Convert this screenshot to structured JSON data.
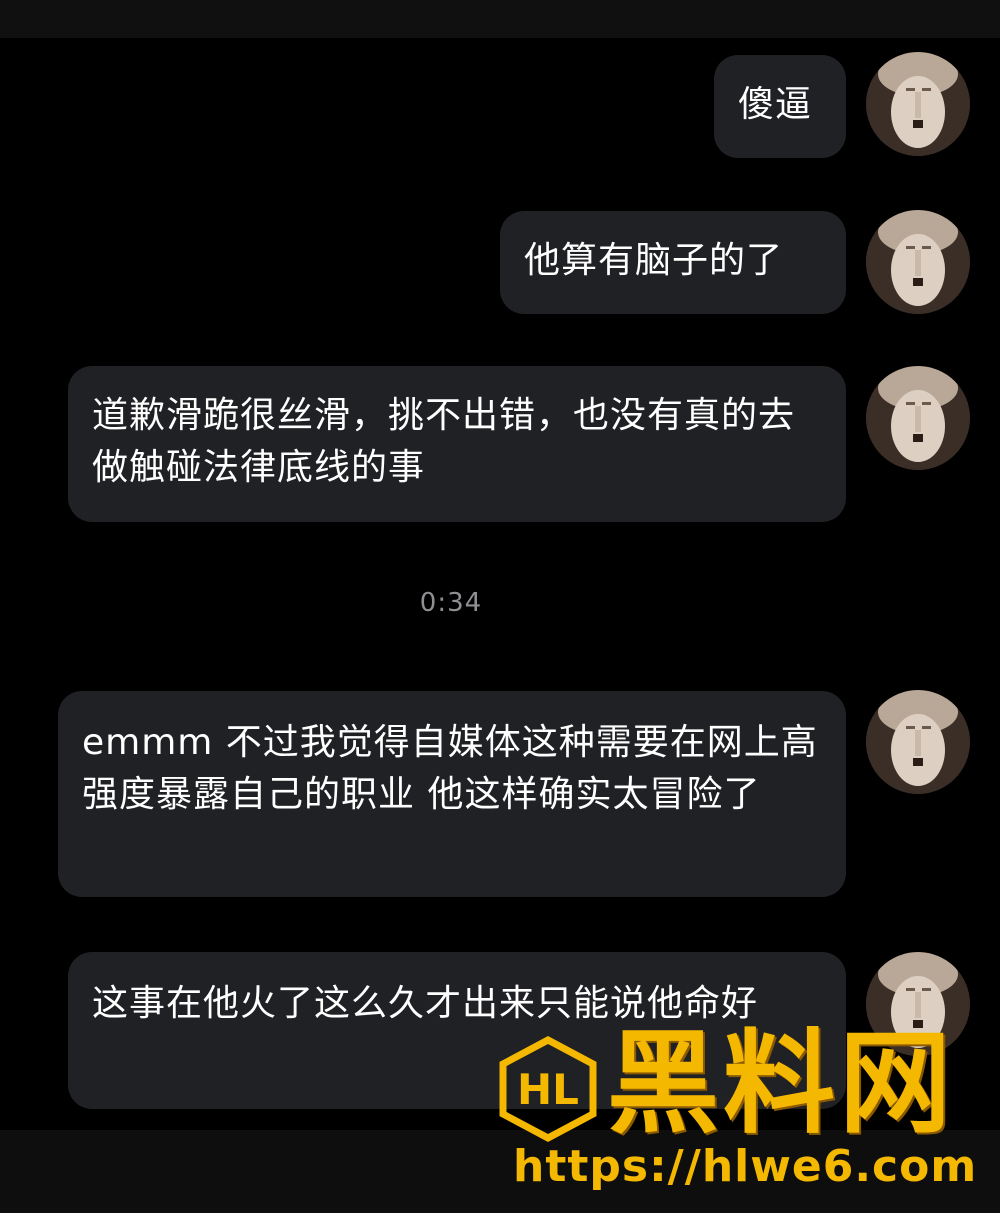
{
  "chat": {
    "timestamp": "0:34",
    "messages": [
      {
        "text": "傻逼"
      },
      {
        "text": "他算有脑子的了"
      },
      {
        "text": "道歉滑跪很丝滑，挑不出错，也没有真的去做触碰法律底线的事"
      },
      {
        "text": "emmm 不过我觉得自媒体这种需要在网上高强度暴露自己的职业 他这样确实太冒险了"
      },
      {
        "text": "这事在他火了这么久才出来只能说他命好"
      }
    ]
  },
  "watermark": {
    "logo_text": "HL",
    "title": "黑料网",
    "url": "https://hlwe6.com"
  },
  "colors": {
    "background": "#000000",
    "bubble": "#202124",
    "text": "#ffffff",
    "timestamp": "#8e8e93",
    "watermark": "#f5b800"
  }
}
